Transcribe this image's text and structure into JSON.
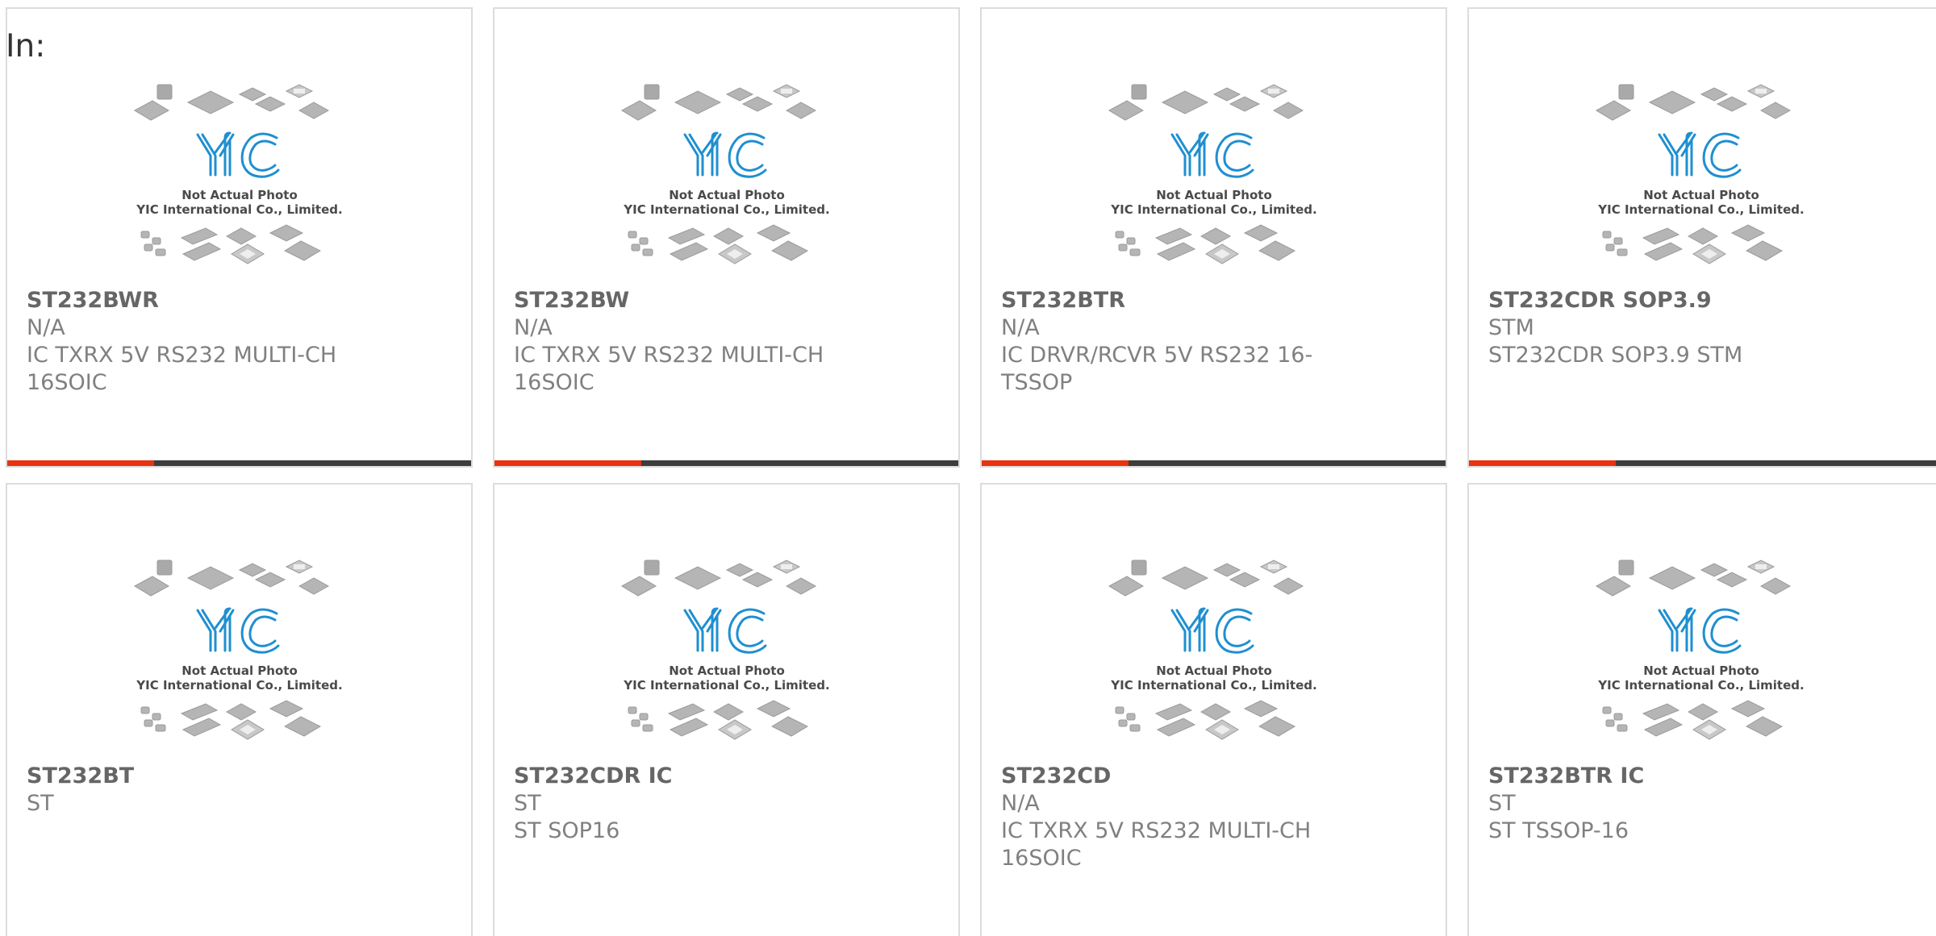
{
  "header": {
    "in_label": "In:"
  },
  "colors": {
    "accent": "#e8330e",
    "bar": "#3d3d3d",
    "border": "#dcdcdc",
    "logo_blue": "#1f8fd0"
  },
  "placeholder": {
    "icon": "yic-not-actual-photo-image",
    "line1": "Not Actual Photo",
    "line2": "YIC International Co., Limited."
  },
  "products": [
    {
      "name": "ST232BWR",
      "manufacturer": "N/A",
      "description": "IC TXRX 5V RS232 MULTI-CH 16SOIC"
    },
    {
      "name": "ST232BW",
      "manufacturer": "N/A",
      "description": "IC TXRX 5V RS232 MULTI-CH 16SOIC"
    },
    {
      "name": "ST232BTR",
      "manufacturer": "N/A",
      "description": "IC DRVR/RCVR 5V RS232 16-TSSOP"
    },
    {
      "name": "ST232CDR SOP3.9",
      "manufacturer": "STM",
      "description": "ST232CDR SOP3.9 STM"
    },
    {
      "name": "ST232BT",
      "manufacturer": "ST",
      "description": ""
    },
    {
      "name": "ST232CDR IC",
      "manufacturer": "ST",
      "description": "ST SOP16"
    },
    {
      "name": "ST232CD",
      "manufacturer": "N/A",
      "description": "IC TXRX 5V RS232 MULTI-CH 16SOIC"
    },
    {
      "name": "ST232BTR IC",
      "manufacturer": "ST",
      "description": "ST TSSOP-16"
    }
  ]
}
